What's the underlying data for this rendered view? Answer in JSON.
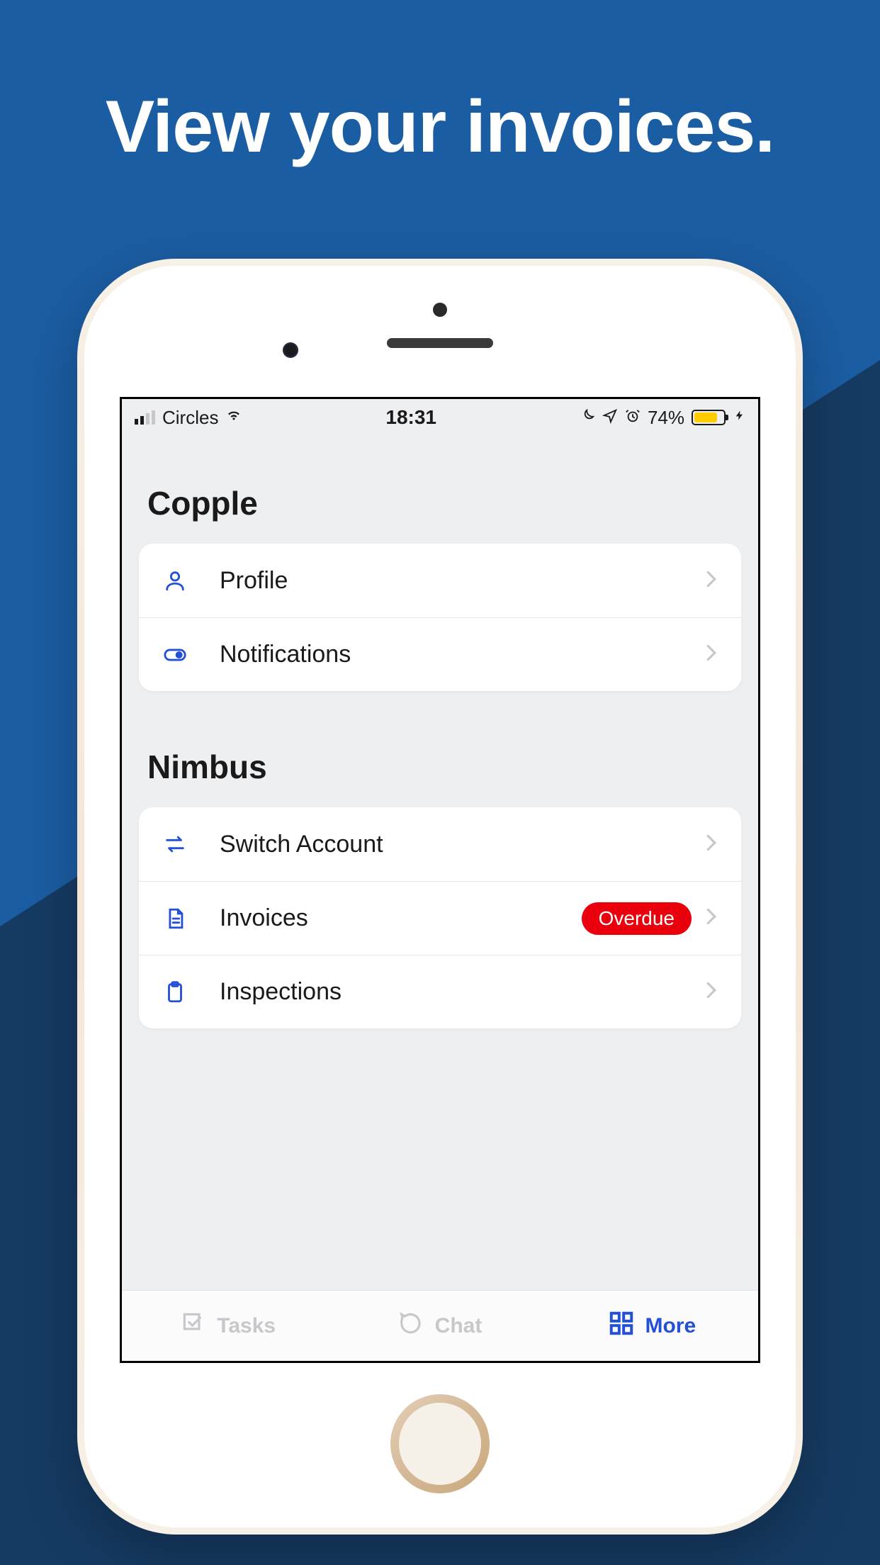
{
  "promo": {
    "title": "View your invoices."
  },
  "statusbar": {
    "carrier": "Circles",
    "time": "18:31",
    "battery_pct": "74%"
  },
  "sections": [
    {
      "title": "Copple",
      "rows": [
        {
          "icon": "person-icon",
          "label": "Profile",
          "badge": null
        },
        {
          "icon": "toggle-icon",
          "label": "Notifications",
          "badge": null
        }
      ]
    },
    {
      "title": "Nimbus",
      "rows": [
        {
          "icon": "switch-icon",
          "label": "Switch Account",
          "badge": null
        },
        {
          "icon": "document-icon",
          "label": "Invoices",
          "badge": "Overdue"
        },
        {
          "icon": "clipboard-icon",
          "label": "Inspections",
          "badge": null
        }
      ]
    }
  ],
  "tabs": [
    {
      "icon": "tasks-icon",
      "label": "Tasks",
      "active": false
    },
    {
      "icon": "chat-icon",
      "label": "Chat",
      "active": false
    },
    {
      "icon": "grid-icon",
      "label": "More",
      "active": true
    }
  ],
  "colors": {
    "accent": "#2450d6",
    "danger": "#e9000c",
    "bg_top": "#1b5da3",
    "bg_bottom": "#163b63"
  }
}
